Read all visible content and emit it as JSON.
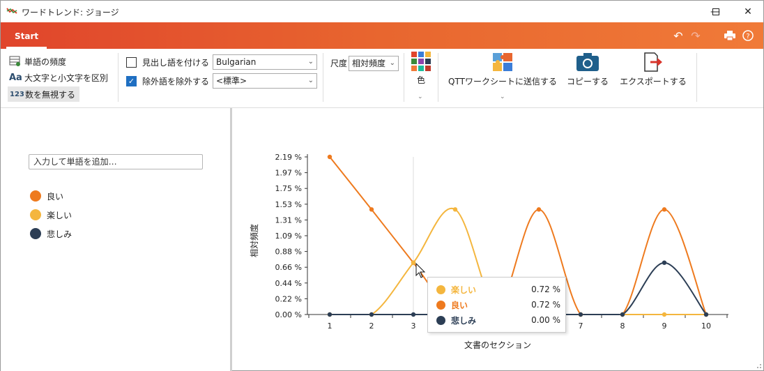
{
  "window": {
    "title": "ワードトレンド: ジョージ"
  },
  "ribbon_tabs": {
    "start": "Start"
  },
  "ribbon": {
    "word_freq": "単語の頻度",
    "case_sensitive": "大文字と小文字を区別",
    "ignore_numbers": "数を無視する",
    "lemmatize_label": "見出し語を付ける",
    "lemmatize_checked": false,
    "language_value": "Bulgarian",
    "exclude_label": "除外語を除外する",
    "exclude_checked": true,
    "exclude_value": "<標準>",
    "scale_label": "尺度",
    "scale_value": "相対頻度",
    "color_label": "色",
    "send_label": "QTTワークシートに送信する",
    "copy_label": "コピーする",
    "export_label": "エクスポートする"
  },
  "left_panel": {
    "input_placeholder": "入力して単語を追加…",
    "legend": [
      {
        "label": "良い",
        "color": "#ee7a1e"
      },
      {
        "label": "楽しい",
        "color": "#f4b63e"
      },
      {
        "label": "悲しみ",
        "color": "#2c3e55"
      }
    ]
  },
  "tooltip": {
    "rows": [
      {
        "name": "楽しい",
        "value": "0.72 %",
        "color": "#f4b63e"
      },
      {
        "name": "良い",
        "value": "0.72 %",
        "color": "#ee7a1e"
      },
      {
        "name": "悲しみ",
        "value": "0.00 %",
        "color": "#2c3e55"
      }
    ]
  },
  "chart_data": {
    "type": "line",
    "xlabel": "文書のセクション",
    "ylabel": "相対頻度",
    "categories": [
      "1",
      "2",
      "3",
      "4",
      "5",
      "6",
      "7",
      "8",
      "9",
      "10"
    ],
    "y_ticks": [
      "0.00 %",
      "0.22 %",
      "0.44 %",
      "0.66 %",
      "0.88 %",
      "1.09 %",
      "1.31 %",
      "1.53 %",
      "1.75 %",
      "1.97 %",
      "2.19 %"
    ],
    "ylim": [
      0,
      2.19
    ],
    "series": [
      {
        "name": "良い",
        "color": "#ee7a1e",
        "values": [
          2.19,
          1.46,
          0.72,
          0,
          0,
          1.46,
          0,
          0,
          1.46,
          0
        ]
      },
      {
        "name": "楽しい",
        "color": "#f4b63e",
        "values": [
          0,
          0,
          0.72,
          1.46,
          0,
          0,
          0,
          0,
          0,
          0
        ]
      },
      {
        "name": "悲しみ",
        "color": "#2c3e55",
        "values": [
          0,
          0,
          0,
          0,
          0,
          0,
          0,
          0,
          0.72,
          0
        ]
      }
    ]
  }
}
